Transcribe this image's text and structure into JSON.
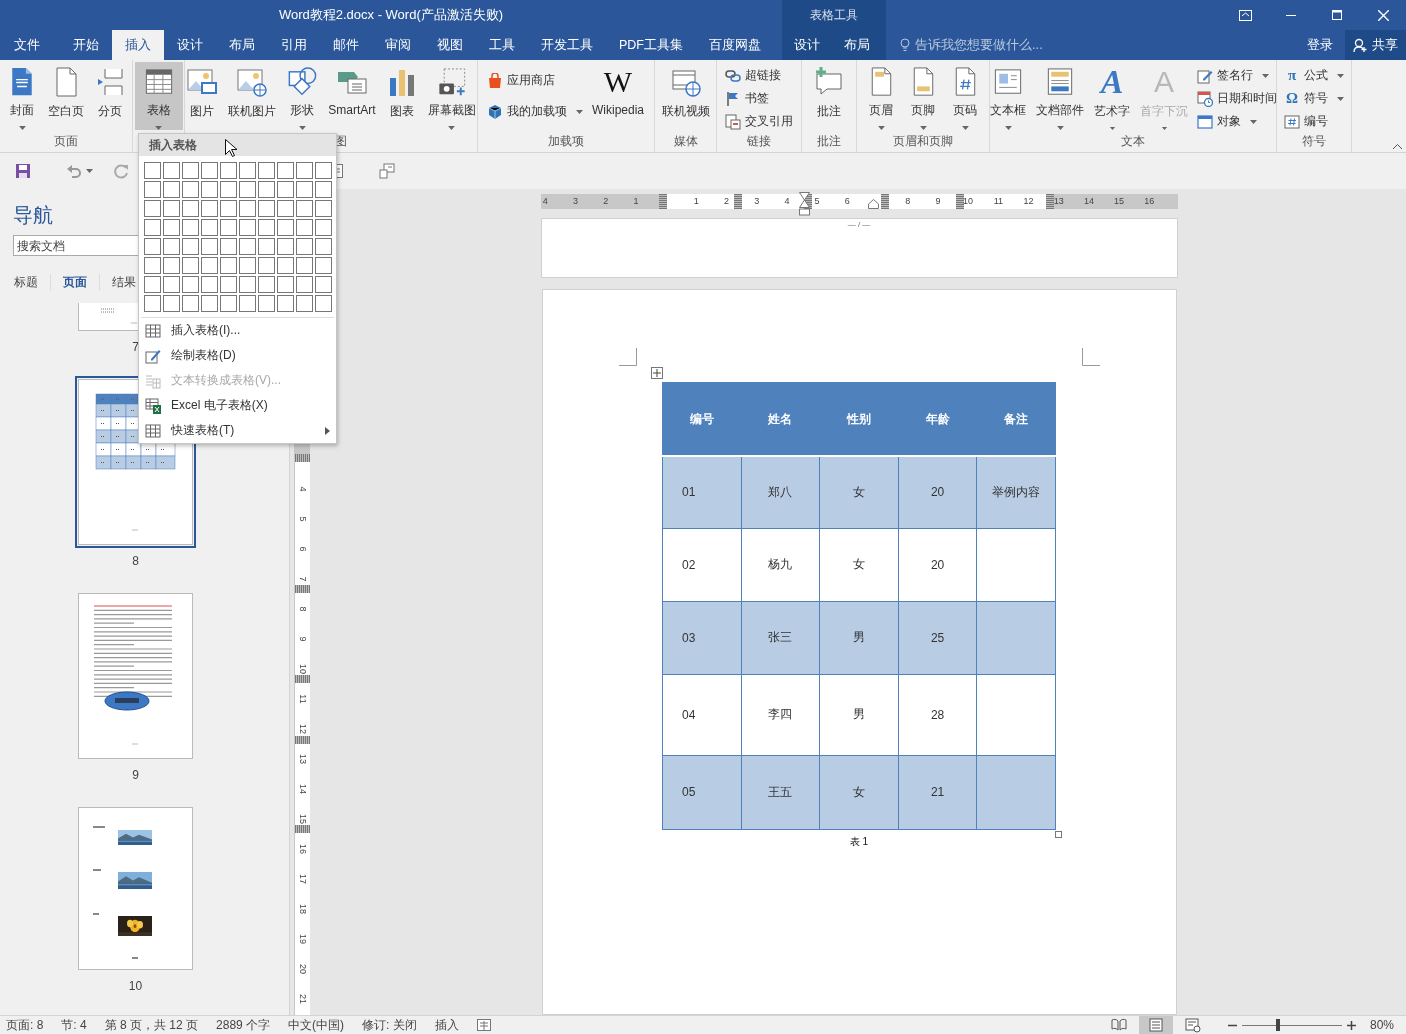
{
  "window": {
    "title": "Word教程2.docx - Word(产品激活失败)",
    "context_title": "表格工具"
  },
  "tabs": [
    {
      "label": "文件",
      "selected": false
    },
    {
      "label": "开始",
      "selected": false
    },
    {
      "label": "插入",
      "selected": true
    },
    {
      "label": "设计",
      "selected": false
    },
    {
      "label": "布局",
      "selected": false
    },
    {
      "label": "引用",
      "selected": false
    },
    {
      "label": "邮件",
      "selected": false
    },
    {
      "label": "审阅",
      "selected": false
    },
    {
      "label": "视图",
      "selected": false
    },
    {
      "label": "工具",
      "selected": false
    },
    {
      "label": "开发工具",
      "selected": false
    },
    {
      "label": "PDF工具集",
      "selected": false
    },
    {
      "label": "百度网盘",
      "selected": false
    }
  ],
  "context_tabs": [
    {
      "label": "设计",
      "selected": false
    },
    {
      "label": "布局",
      "selected": false
    }
  ],
  "tell_me": {
    "placeholder": "告诉我您想要做什么..."
  },
  "account": {
    "sign_in": "登录",
    "share": "共享"
  },
  "ribbon": {
    "groups": [
      {
        "label": "页面",
        "items": [
          {
            "kind": "large",
            "label": "封面",
            "dropdown": true
          },
          {
            "kind": "large",
            "label": "空白页"
          },
          {
            "kind": "large",
            "label": "分页"
          }
        ]
      },
      {
        "items": [
          {
            "kind": "large",
            "label": "表格",
            "dropdown": true,
            "pressed": true
          }
        ]
      },
      {
        "label": "图",
        "covered": true,
        "items": [
          {
            "kind": "large",
            "label": "图片"
          },
          {
            "kind": "large",
            "label": "联机图片"
          },
          {
            "kind": "large",
            "label": "形状",
            "dropdown": true
          },
          {
            "kind": "large",
            "label": "SmartArt"
          },
          {
            "kind": "large",
            "label": "图表"
          },
          {
            "kind": "large",
            "label": "屏幕截图",
            "dropdown": true
          }
        ]
      },
      {
        "label": "加载项",
        "items": [
          {
            "kind": "stack",
            "buttons": [
              {
                "label": "应用商店"
              },
              {
                "label": "我的加载项",
                "dropdown": true
              }
            ]
          },
          {
            "kind": "large",
            "label": "Wikipedia",
            "glyph": "W"
          }
        ]
      },
      {
        "label": "媒体",
        "items": [
          {
            "kind": "large",
            "label": "联机视频"
          }
        ]
      },
      {
        "label": "链接",
        "items": [
          {
            "kind": "stack",
            "buttons": [
              {
                "label": "超链接"
              },
              {
                "label": "书签"
              },
              {
                "label": "交叉引用"
              }
            ]
          }
        ]
      },
      {
        "label": "批注",
        "items": [
          {
            "kind": "large",
            "label": "批注"
          }
        ]
      },
      {
        "label": "页眉和页脚",
        "items": [
          {
            "kind": "large",
            "label": "页眉",
            "dropdown": true
          },
          {
            "kind": "large",
            "label": "页脚",
            "dropdown": true
          },
          {
            "kind": "large",
            "label": "页码",
            "dropdown": true
          }
        ]
      },
      {
        "label": "文本",
        "items": [
          {
            "kind": "large",
            "label": "文本框",
            "dropdown": true
          },
          {
            "kind": "large",
            "label": "文档部件",
            "dropdown": true
          },
          {
            "kind": "large",
            "label": "艺术字",
            "glyph": "A",
            "dropdown": true
          },
          {
            "kind": "large",
            "label": "首字下沉",
            "glyph": "A",
            "dropdown": true,
            "disabled": true
          },
          {
            "kind": "stack",
            "buttons": [
              {
                "label": "签名行",
                "dropdown": true
              },
              {
                "label": "日期和时间"
              },
              {
                "label": "对象",
                "dropdown": true
              }
            ]
          }
        ]
      },
      {
        "label": "符号",
        "items": [
          {
            "kind": "stack",
            "buttons": [
              {
                "label": "公式",
                "glyph": "π",
                "dropdown": true
              },
              {
                "label": "符号",
                "glyph": "Ω",
                "dropdown": true
              },
              {
                "label": "编号"
              }
            ]
          }
        ]
      }
    ]
  },
  "table_menu": {
    "header": "插入表格",
    "items": [
      {
        "label": "插入表格(I)...",
        "disabled": false
      },
      {
        "label": "绘制表格(D)",
        "disabled": false
      },
      {
        "label": "文本转换成表格(V)...",
        "disabled": true
      },
      {
        "label": "Excel 电子表格(X)",
        "disabled": false
      },
      {
        "label": "快速表格(T)",
        "disabled": false,
        "submenu": true
      }
    ]
  },
  "nav": {
    "title": "导航",
    "search": {
      "placeholder": "搜索文档"
    },
    "tabs": [
      {
        "label": "标题",
        "selected": false
      },
      {
        "label": "页面",
        "selected": true
      },
      {
        "label": "结果",
        "selected": false
      }
    ],
    "pages": [
      {
        "number": "7",
        "kind": "partial",
        "selected": false
      },
      {
        "number": "8",
        "kind": "table",
        "selected": true
      },
      {
        "number": "9",
        "kind": "text",
        "selected": false
      },
      {
        "number": "10",
        "kind": "pictures",
        "selected": false
      }
    ]
  },
  "rulers": {
    "horizontal": [
      "4",
      "3",
      "2",
      "1",
      "1",
      "2",
      "3",
      "4",
      "5",
      "6",
      "8",
      "9",
      "10",
      "11",
      "12",
      "13",
      "14",
      "15",
      "16"
    ],
    "vertical": [
      "4",
      "5",
      "6",
      "7",
      "8",
      "9",
      "10",
      "11",
      "12",
      "13",
      "14",
      "15",
      "16",
      "17",
      "18",
      "19",
      "20",
      "21"
    ]
  },
  "document": {
    "prev_page_footer": "— / —",
    "table": {
      "columns": [
        "编号",
        "姓名",
        "性别",
        "年龄",
        "备注"
      ],
      "rows": [
        [
          "01",
          "郑八",
          "女",
          "20",
          "举例内容"
        ],
        [
          "02",
          "杨九",
          "女",
          "20"
        ],
        [
          "03",
          "张三",
          "男",
          "25"
        ],
        [
          "04",
          "李四",
          "男",
          "28"
        ],
        [
          "05",
          "王五",
          "女",
          "21"
        ]
      ]
    },
    "caption": "表 1"
  },
  "status_bar": {
    "items": [
      "页面: 8",
      "节: 4",
      "第 8 页，共 12 页",
      "2889 个字",
      "中文(中国)",
      "修订: 关闭",
      "插入"
    ],
    "views": [
      {
        "selected": false
      },
      {
        "selected": true
      },
      {
        "selected": false
      }
    ],
    "zoom": {
      "level": 0.36,
      "label": "80%"
    }
  }
}
